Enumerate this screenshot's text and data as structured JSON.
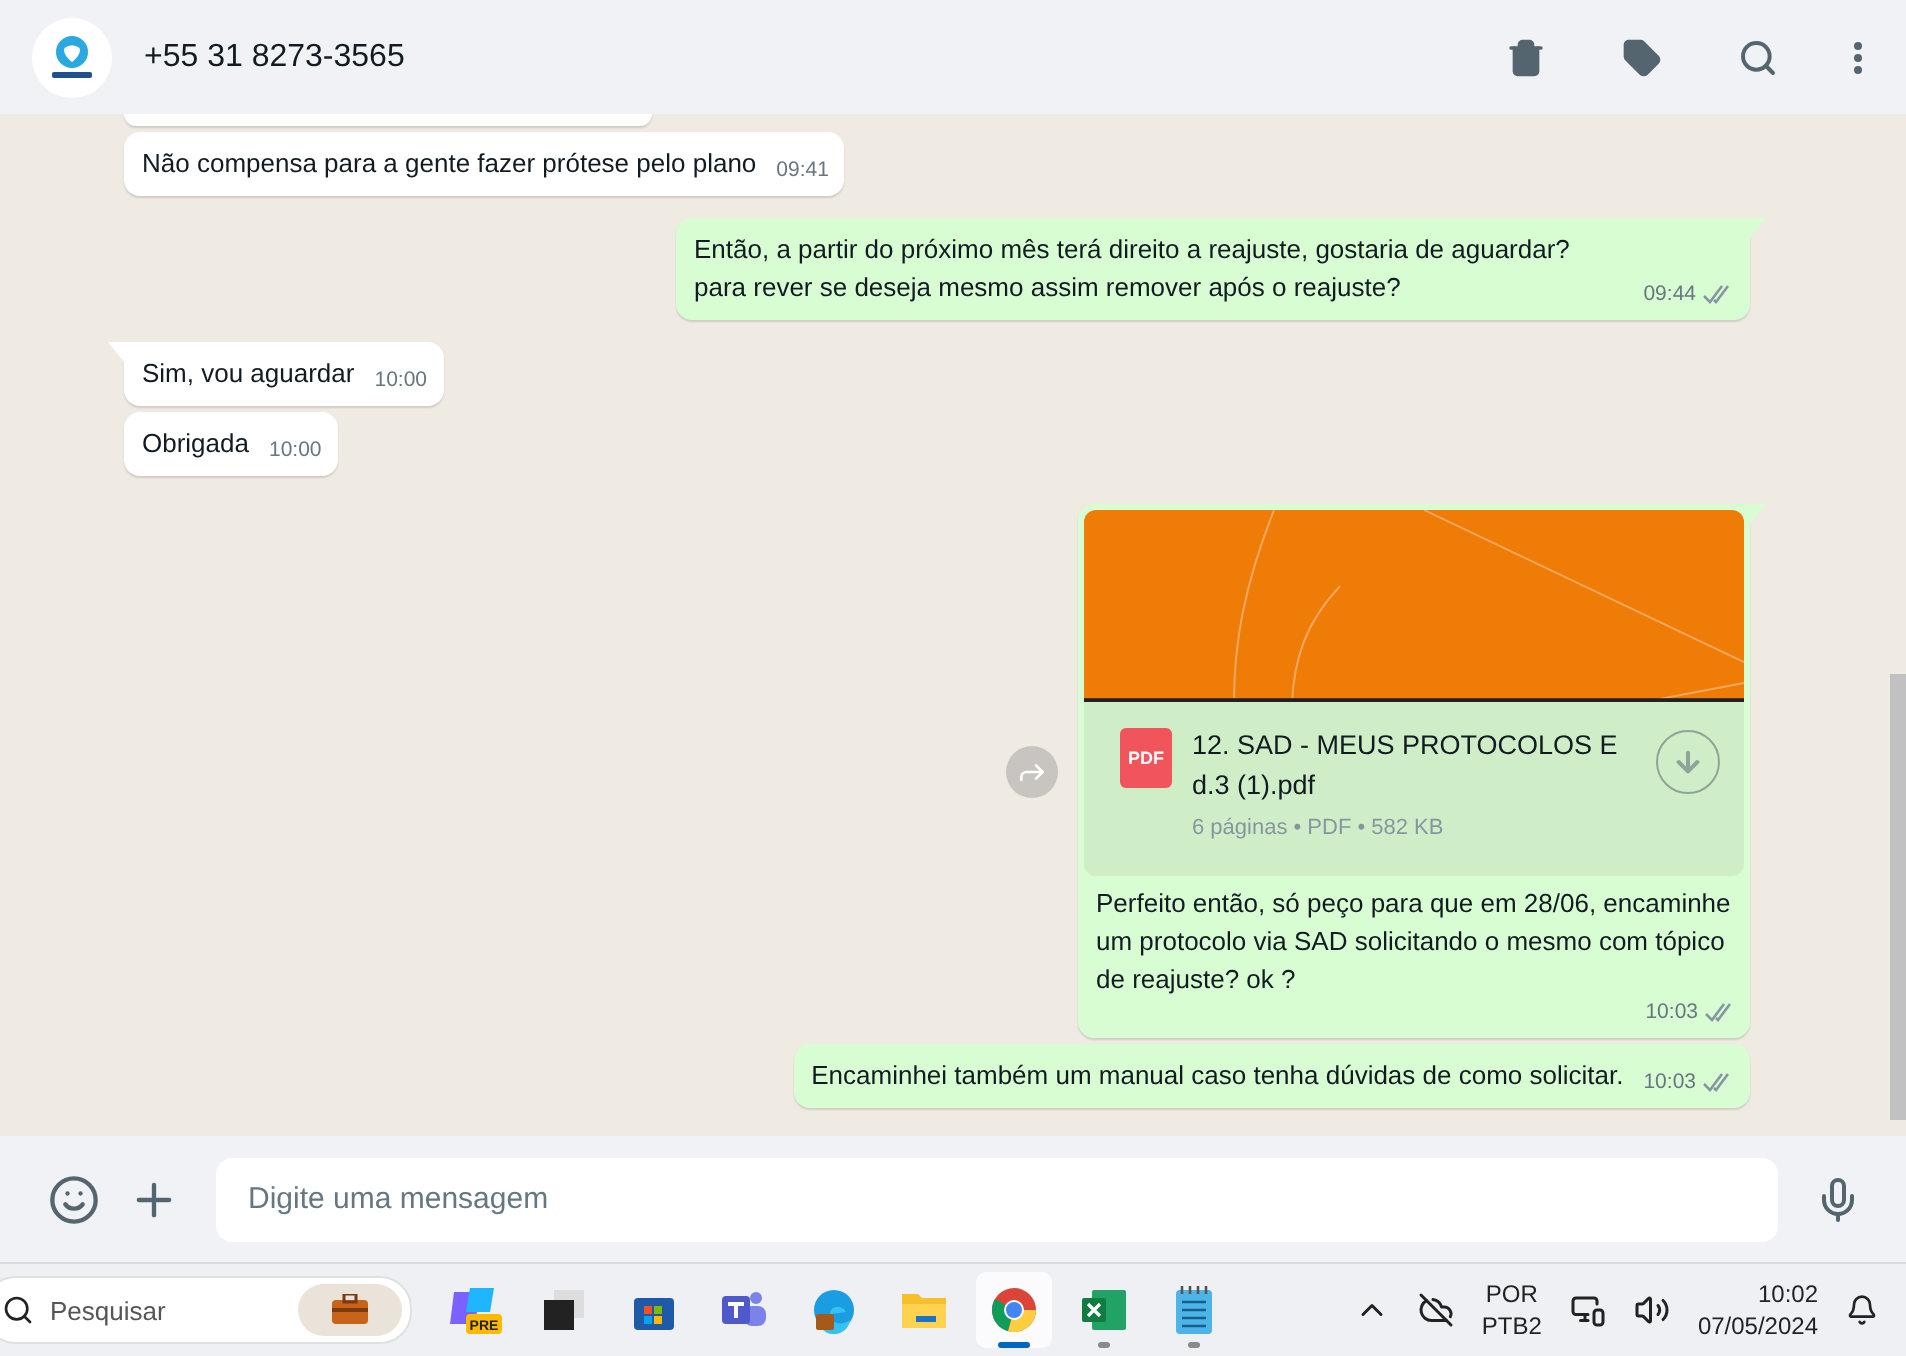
{
  "header": {
    "contact": "+55 31 8273-3565"
  },
  "messages": [
    {
      "kind": "text",
      "outgoing": false,
      "tail": false,
      "text": "Não compensa para a gente fazer prótese pelo plano",
      "time": "09:41"
    },
    {
      "kind": "text",
      "outgoing": true,
      "tail": true,
      "text": "Então, a partir do próximo mês terá direito a reajuste, gostaria de aguardar? para rever se deseja mesmo assim remover após o reajuste?",
      "time": "09:44",
      "ticks": true
    },
    {
      "kind": "text",
      "outgoing": false,
      "tail": true,
      "text": "Sim, vou aguardar",
      "time": "10:00"
    },
    {
      "kind": "text",
      "outgoing": false,
      "tail": false,
      "text": "Obrigada",
      "time": "10:00"
    },
    {
      "kind": "document",
      "outgoing": true,
      "tail": true,
      "file_badge": "PDF",
      "file_name": "12. SAD - MEUS PROTOCOLOS E d.3 (1).pdf",
      "file_meta": "6 páginas • PDF • 582 KB",
      "text": "Perfeito então, só peço para que em 28/06, encaminhe um protocolo via SAD solicitando o mesmo com tópico de reajuste? ok ?",
      "time": "10:03",
      "ticks": true
    },
    {
      "kind": "text",
      "outgoing": true,
      "tail": false,
      "text": "Encaminhei também um manual caso tenha dúvidas de como solicitar.",
      "time": "10:03",
      "ticks": true
    }
  ],
  "composer": {
    "placeholder": "Digite uma mensagem"
  },
  "taskbar": {
    "search_placeholder": "Pesquisar",
    "apps": [
      {
        "kind": "copilot",
        "badge": "PRE",
        "selected": false,
        "running": false
      },
      {
        "kind": "window",
        "selected": false,
        "running": false
      },
      {
        "kind": "store",
        "selected": false,
        "running": false
      },
      {
        "kind": "teams",
        "selected": false,
        "running": false
      },
      {
        "kind": "edge",
        "selected": false,
        "running": false
      },
      {
        "kind": "folder",
        "selected": false,
        "running": false
      },
      {
        "kind": "chrome",
        "selected": true,
        "running": true
      },
      {
        "kind": "excel",
        "selected": false,
        "running": true
      },
      {
        "kind": "notepad",
        "selected": false,
        "running": true
      }
    ],
    "language": "POR",
    "layout": "PTB2",
    "time": "10:02",
    "date": "07/05/2024"
  }
}
